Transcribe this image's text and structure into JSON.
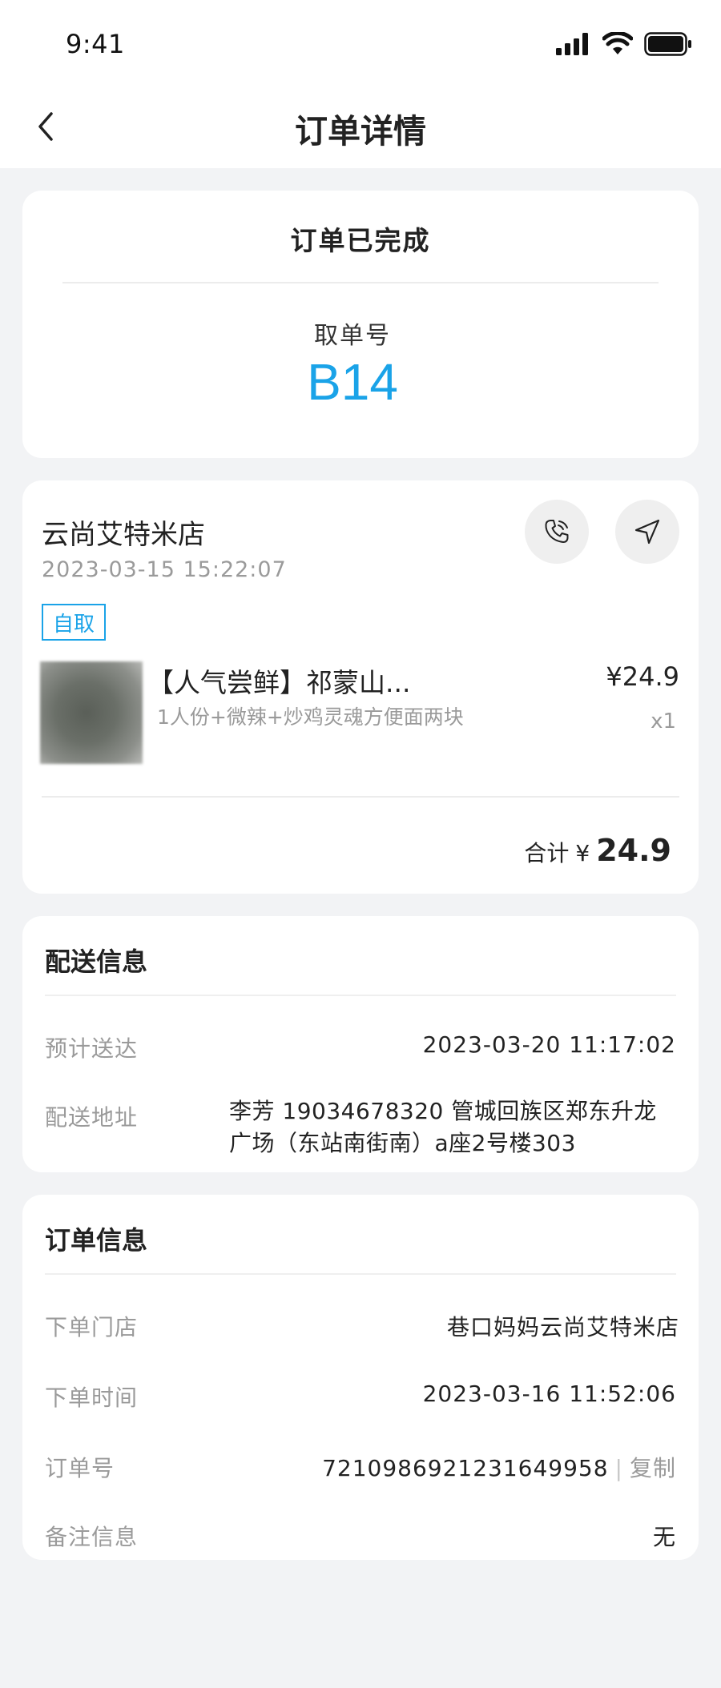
{
  "status_bar": {
    "time": "9:41"
  },
  "nav": {
    "title": "订单详情"
  },
  "order_status": {
    "status": "订单已完成",
    "pickup_label": "取单号",
    "pickup_number": "B14"
  },
  "store": {
    "name": "云尚艾特米店",
    "time": "2023-03-15 15:22:07",
    "tag": "自取",
    "item": {
      "name": "【人气尝鲜】祁蒙山...",
      "desc": "1人份+微辣+炒鸡灵魂方便面两块",
      "price": "¥24.9",
      "qty": "x1"
    },
    "total_label": "合计",
    "total_currency": "¥",
    "total_amount": "24.9"
  },
  "delivery": {
    "title": "配送信息",
    "eta_label": "预计送达",
    "eta_value": "2023-03-20 11:17:02",
    "address_label": "配送地址",
    "address_value": "李芳 19034678320 管城回族区郑东升龙广场（东站南街南）a座2号楼303"
  },
  "order_info": {
    "title": "订单信息",
    "store_label": "下单门店",
    "store_value": "巷口妈妈云尚艾特米店",
    "time_label": "下单时间",
    "time_value": "2023-03-16 11:52:06",
    "order_no_label": "订单号",
    "order_no_value": "7210986921231649958",
    "copy_separator": "|",
    "copy_label": "复制",
    "remark_label": "备注信息",
    "remark_value": "无"
  },
  "colors": {
    "accent": "#1aa3e8",
    "background": "#f2f3f5",
    "muted_text": "#9a9a9a"
  }
}
